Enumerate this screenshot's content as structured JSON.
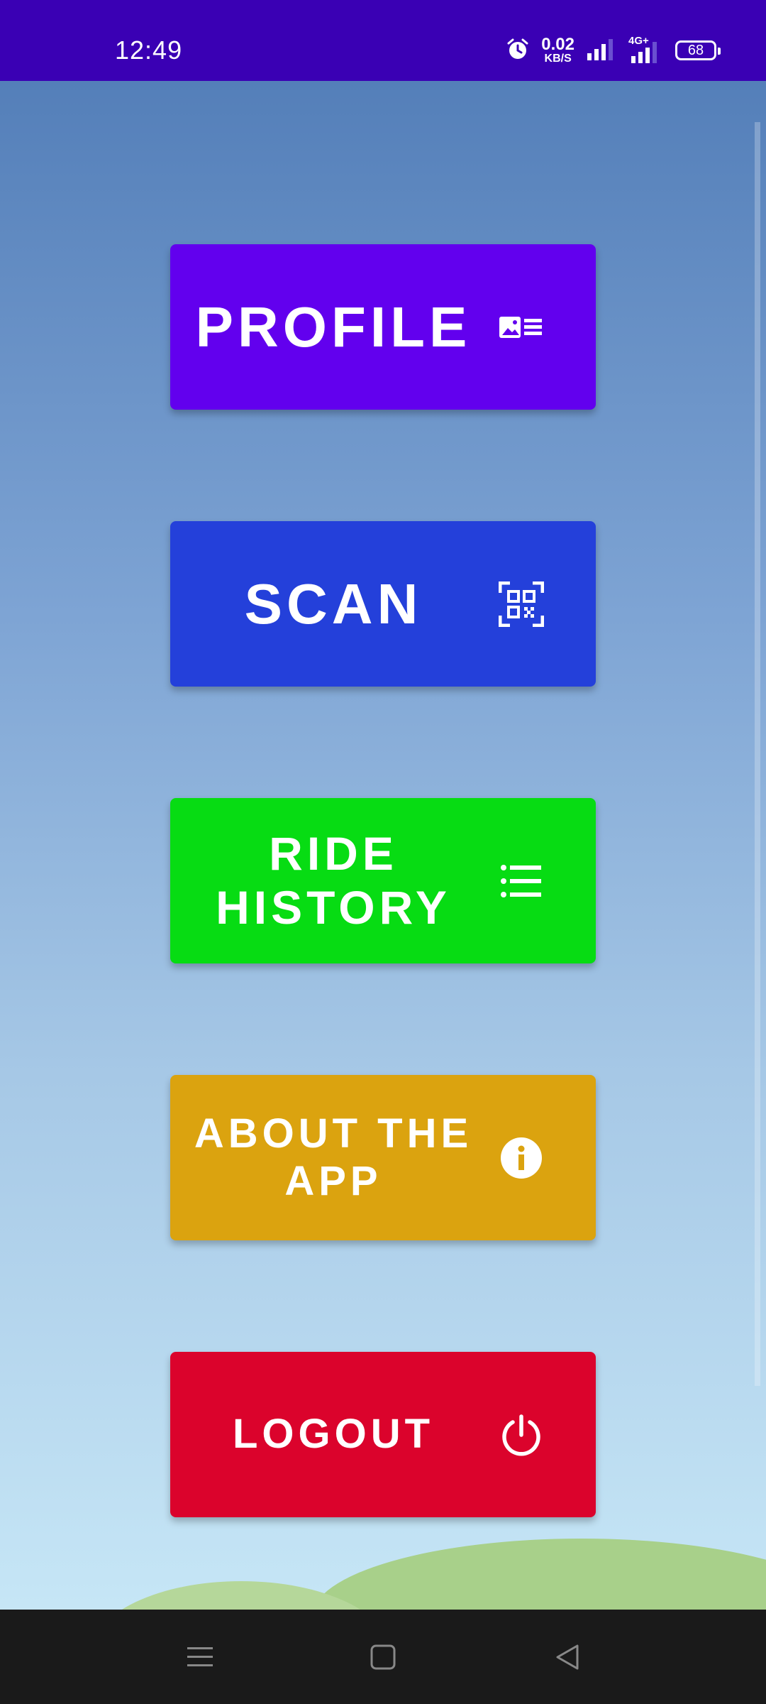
{
  "status_bar": {
    "time": "12:49",
    "net_speed_value": "0.02",
    "net_speed_unit": "KB/S",
    "network_type": "4G+",
    "battery_level": "68",
    "color": "#3a00b4"
  },
  "menu": {
    "buttons": [
      {
        "label": "PROFILE",
        "color": "#6200ee",
        "icon": "profile-card-icon"
      },
      {
        "label": "SCAN",
        "color": "#2440da",
        "icon": "qr-scan-icon"
      },
      {
        "label": "RIDE\nHISTORY",
        "color": "#07dc13",
        "icon": "list-icon"
      },
      {
        "label": "ABOUT THE\nAPP",
        "color": "#dba30f",
        "icon": "info-icon"
      },
      {
        "label": "LOGOUT",
        "color": "#db032c",
        "icon": "power-icon"
      }
    ]
  },
  "nav_bar": {
    "items": [
      "menu-icon",
      "home-icon",
      "back-icon"
    ]
  }
}
